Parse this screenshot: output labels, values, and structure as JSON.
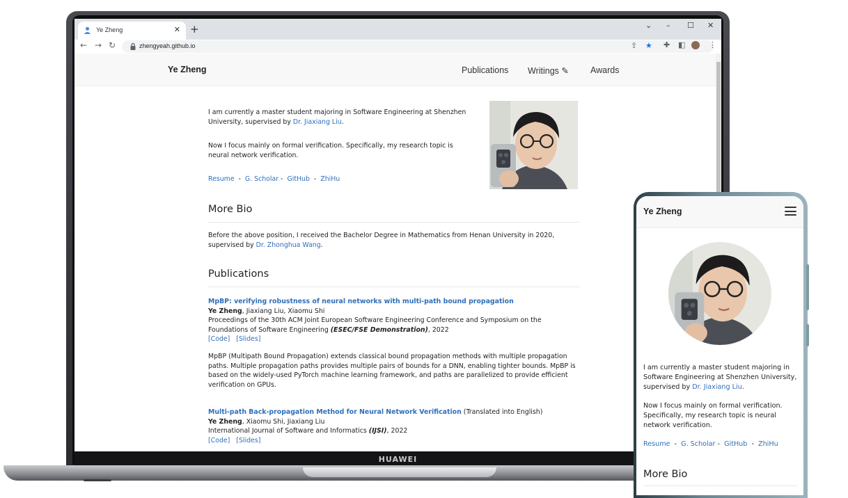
{
  "laptop": {
    "brand": "HUAWEI"
  },
  "browser": {
    "tab_title": "Ye Zheng",
    "new_tab": "+",
    "url": "zhengyeah.github.io"
  },
  "site": {
    "brand": "Ye Zheng",
    "nav": [
      "Publications",
      "Writings ✎",
      "Awards"
    ],
    "intro_1_pre": "I am currently a master student majoring in Software Engineering at Shenzhen University, supervised by ",
    "intro_1_link": "Dr. Jiaxiang Liu",
    "intro_1_post": ".",
    "intro_2": "Now I focus mainly on formal verification. Specifically, my research topic is neural network verification.",
    "links": [
      "Resume",
      "G. Scholar",
      "GitHub",
      "ZhiHu"
    ],
    "more_bio_heading": "More Bio",
    "bio_pre": "Before the above position, I received the Bachelor Degree in Mathematics from Henan University in 2020, supervised by ",
    "bio_link": "Dr. Zhonghua Wang",
    "bio_post": ".",
    "publications_heading": "Publications",
    "publications": [
      {
        "title": "MpBP: verifying robustness of neural networks with multi-path bound propagation",
        "title_suffix": "",
        "author_self": "Ye Zheng",
        "authors_rest": ", Jiaxiang Liu, Xiaomu Shi",
        "venue_pre": "Proceedings of the 30th ACM Joint European Software Engineering Conference and Symposium on the Foundations of Software Engineering ",
        "venue_em": "(ESEC/FSE Demonstration)",
        "venue_post": ", 2022",
        "code": "[Code]",
        "slides": "[Slides]",
        "abstract": "MpBP (Multipath Bound Propagation) extends classical bound propagation methods with multiple propagation paths. Multiple propagation paths provides multiple pairs of bounds for a DNN, enabling tighter bounds. MpBP is based on the widely-used PyTorch machine learning framework, and paths are parallelized to provide efficient verification on GPUs."
      },
      {
        "title": "Multi-path Back-propagation Method for Neural Network Verification",
        "title_suffix": " (Translated into English)",
        "author_self": "Ye Zheng",
        "authors_rest": ", Xiaomu Shi, Jiaxiang Liu",
        "venue_pre": "International Journal of Software and Informatics ",
        "venue_em": "(IJSI)",
        "venue_post": ", 2022",
        "code": "[Code]",
        "slides": "[Slides]"
      }
    ]
  },
  "colors": {
    "link": "#2f6fba",
    "nav_bg": "#f8f8f8",
    "star": "#1a73e8"
  }
}
